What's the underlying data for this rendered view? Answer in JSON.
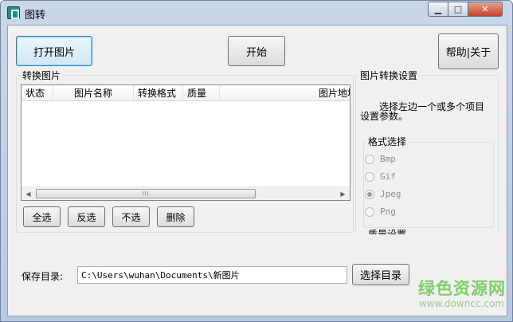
{
  "window": {
    "title": "图转",
    "caption_buttons": {
      "minimize": "▁",
      "maximize": "□",
      "close": "✕"
    }
  },
  "toolbar": {
    "open_label": "打开图片",
    "start_label": "开始",
    "help_label": "帮助|关于"
  },
  "convert_group": {
    "label": "转换图片",
    "columns": [
      "状态",
      "图片名称",
      "转换格式",
      "质量",
      "图片地址"
    ],
    "rows": [],
    "scroll_thumb_grip": "III",
    "buttons": {
      "select_all": "全选",
      "invert": "反选",
      "deselect": "不选",
      "delete": "删除"
    }
  },
  "settings_group": {
    "label": "图片转换设置",
    "description_line1": "选择左边一个或多个项目",
    "description_line2": "设置参数。",
    "format_group_label": "格式选择",
    "formats": [
      "Bmp",
      "Gif",
      "Jpeg",
      "Png"
    ],
    "selected_format": "Jpeg",
    "next_group_label": "质量设置"
  },
  "save": {
    "label": "保存目录:",
    "path_value": "C:\\Users\\wuhan\\Documents\\新图片",
    "choose_dir_label": "选择目录"
  },
  "watermark": {
    "cn": "绿色资源网",
    "url": "www.downcc.com",
    "color": "#7fcf6b"
  }
}
